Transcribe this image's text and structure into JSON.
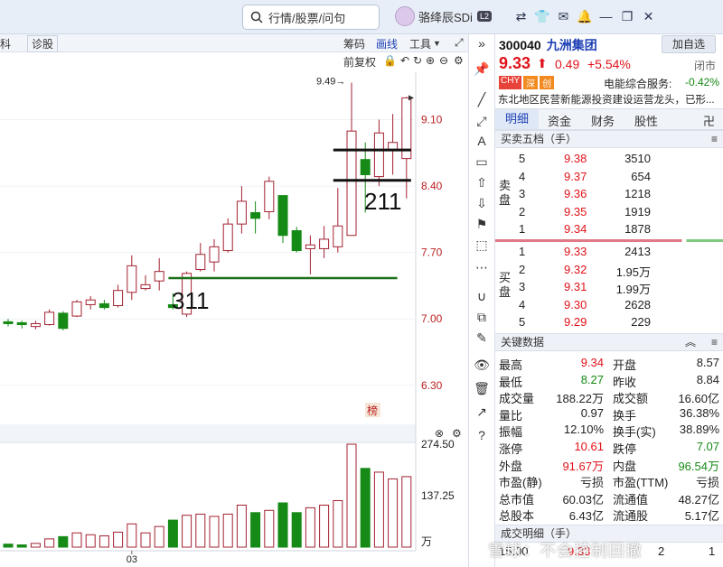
{
  "topbar": {
    "search_placeholder": "行情/股票/问句",
    "username": "骆绛辰SDi",
    "level": "L2"
  },
  "toolbar": {
    "left_partial": "科",
    "diag": "诊股",
    "chip": "筹码",
    "draw": "画线",
    "tools": "工具",
    "fuquan": "前复权"
  },
  "price_axis": [
    "9.10",
    "8.40",
    "7.70",
    "7.00",
    "6.30"
  ],
  "vol_axis": [
    "274.50",
    "137.25",
    "万"
  ],
  "date_label": "03",
  "annotations": {
    "high_label": "9.49",
    "a1": "311",
    "a2": "211",
    "bang": "榜"
  },
  "stock": {
    "code": "300040",
    "name": "九洲集团",
    "add": "加自选",
    "price": "9.33",
    "change": "0.49",
    "pct": "+5.54%",
    "status": "闭市",
    "tag1": "CHY",
    "tag2": "深",
    "tag3": "创",
    "sector": "电能综合服务:",
    "sector_pct": "-0.42%",
    "desc": "东北地区民营新能源投资建设运营龙头，已形..."
  },
  "tabs": [
    "明细",
    "资金",
    "财务",
    "股性"
  ],
  "orderbook": {
    "title": "买卖五档（手）",
    "sell_label": "卖盘",
    "buy_label": "买盘",
    "asks": [
      {
        "n": "5",
        "p": "9.38",
        "v": "3510"
      },
      {
        "n": "4",
        "p": "9.37",
        "v": "654"
      },
      {
        "n": "3",
        "p": "9.36",
        "v": "1218"
      },
      {
        "n": "2",
        "p": "9.35",
        "v": "1919"
      },
      {
        "n": "1",
        "p": "9.34",
        "v": "1878"
      }
    ],
    "bids": [
      {
        "n": "1",
        "p": "9.33",
        "v": "2413"
      },
      {
        "n": "2",
        "p": "9.32",
        "v": "1.95万"
      },
      {
        "n": "3",
        "p": "9.31",
        "v": "1.99万"
      },
      {
        "n": "4",
        "p": "9.30",
        "v": "2628"
      },
      {
        "n": "5",
        "p": "9.29",
        "v": "229"
      }
    ]
  },
  "key": {
    "title": "关键数据",
    "rows": [
      [
        "最高",
        "9.34",
        "开盘",
        "8.57"
      ],
      [
        "最低",
        "8.27",
        "昨收",
        "8.84"
      ],
      [
        "成交量",
        "188.22万",
        "成交额",
        "16.60亿"
      ],
      [
        "量比",
        "0.97",
        "换手",
        "36.38%"
      ],
      [
        "振幅",
        "12.10%",
        "换手(实)",
        "38.89%"
      ],
      [
        "涨停",
        "10.61",
        "跌停",
        "7.07"
      ],
      [
        "外盘",
        "91.67万",
        "内盘",
        "96.54万"
      ],
      [
        "市盈(静)",
        "亏损",
        "市盈(TTM)",
        "亏损"
      ],
      [
        "总市值",
        "60.03亿",
        "流通值",
        "48.27亿"
      ],
      [
        "总股本",
        "6.43亿",
        "流通股",
        "5.17亿"
      ]
    ]
  },
  "trades": {
    "title": "成交明细（手）",
    "row": {
      "t": "15:00",
      "p": "9.33",
      "v": "2",
      "n": "1"
    }
  },
  "watermark": "雪球：不会控制回撤",
  "colors": {
    "up": "#e0131a",
    "down": "#168a16",
    "accent": "#1d3fb5"
  },
  "chart_data": {
    "type": "candlestick",
    "candles": [
      {
        "o": 6.97,
        "c": 6.95,
        "h": 7.0,
        "l": 6.92
      },
      {
        "o": 6.96,
        "c": 6.94,
        "h": 6.98,
        "l": 6.9
      },
      {
        "o": 6.92,
        "c": 6.95,
        "h": 6.98,
        "l": 6.89
      },
      {
        "o": 6.94,
        "c": 7.07,
        "h": 7.1,
        "l": 6.93
      },
      {
        "o": 7.06,
        "c": 6.9,
        "h": 7.08,
        "l": 6.88
      },
      {
        "o": 7.03,
        "c": 7.18,
        "h": 7.2,
        "l": 7.02
      },
      {
        "o": 7.15,
        "c": 7.2,
        "h": 7.24,
        "l": 7.1
      },
      {
        "o": 7.16,
        "c": 7.12,
        "h": 7.2,
        "l": 7.1
      },
      {
        "o": 7.14,
        "c": 7.3,
        "h": 7.36,
        "l": 7.12
      },
      {
        "o": 7.28,
        "c": 7.56,
        "h": 7.67,
        "l": 7.2
      },
      {
        "o": 7.32,
        "c": 7.36,
        "h": 7.46,
        "l": 7.3
      },
      {
        "o": 7.4,
        "c": 7.5,
        "h": 7.64,
        "l": 7.3
      },
      {
        "o": 7.15,
        "c": 7.12,
        "h": 7.27,
        "l": 7.1
      },
      {
        "o": 7.05,
        "c": 7.48,
        "h": 7.5,
        "l": 7.02
      },
      {
        "o": 7.52,
        "c": 7.68,
        "h": 7.8,
        "l": 7.5
      },
      {
        "o": 7.6,
        "c": 7.76,
        "h": 7.84,
        "l": 7.5
      },
      {
        "o": 7.72,
        "c": 8.0,
        "h": 8.06,
        "l": 7.7
      },
      {
        "o": 8.0,
        "c": 8.24,
        "h": 8.4,
        "l": 7.9
      },
      {
        "o": 8.12,
        "c": 8.06,
        "h": 8.24,
        "l": 7.9
      },
      {
        "o": 8.13,
        "c": 8.45,
        "h": 8.5,
        "l": 8.05
      },
      {
        "o": 8.3,
        "c": 7.88,
        "h": 8.3,
        "l": 7.8
      },
      {
        "o": 7.93,
        "c": 7.72,
        "h": 7.97,
        "l": 7.7
      },
      {
        "o": 7.74,
        "c": 7.78,
        "h": 7.88,
        "l": 7.47
      },
      {
        "o": 7.74,
        "c": 7.84,
        "h": 7.98,
        "l": 7.64
      },
      {
        "o": 7.76,
        "c": 7.98,
        "h": 8.38,
        "l": 7.7
      },
      {
        "o": 7.88,
        "c": 8.98,
        "h": 9.49,
        "l": 7.88
      },
      {
        "o": 8.68,
        "c": 8.52,
        "h": 8.86,
        "l": 8.12
      },
      {
        "o": 8.5,
        "c": 8.96,
        "h": 9.1,
        "l": 8.4
      },
      {
        "o": 8.78,
        "c": 8.86,
        "h": 9.16,
        "l": 8.52
      },
      {
        "o": 8.69,
        "c": 9.33,
        "h": 9.34,
        "l": 8.27
      }
    ],
    "volumes": [
      {
        "v": 8,
        "u": 0
      },
      {
        "v": 6,
        "u": 0
      },
      {
        "v": 10,
        "u": 1
      },
      {
        "v": 22,
        "u": 1
      },
      {
        "v": 28,
        "u": 0
      },
      {
        "v": 38,
        "u": 1
      },
      {
        "v": 33,
        "u": 1
      },
      {
        "v": 30,
        "u": 1
      },
      {
        "v": 40,
        "u": 1
      },
      {
        "v": 62,
        "u": 1
      },
      {
        "v": 38,
        "u": 1
      },
      {
        "v": 55,
        "u": 1
      },
      {
        "v": 72,
        "u": 0
      },
      {
        "v": 85,
        "u": 1
      },
      {
        "v": 88,
        "u": 1
      },
      {
        "v": 82,
        "u": 1
      },
      {
        "v": 88,
        "u": 1
      },
      {
        "v": 112,
        "u": 1
      },
      {
        "v": 92,
        "u": 0
      },
      {
        "v": 98,
        "u": 1
      },
      {
        "v": 118,
        "u": 0
      },
      {
        "v": 92,
        "u": 0
      },
      {
        "v": 105,
        "u": 1
      },
      {
        "v": 112,
        "u": 1
      },
      {
        "v": 124,
        "u": 1
      },
      {
        "v": 274.5,
        "u": 1
      },
      {
        "v": 210,
        "u": 0
      },
      {
        "v": 200,
        "u": 1
      },
      {
        "v": 182,
        "u": 1
      },
      {
        "v": 188,
        "u": 1
      }
    ],
    "ylim": [
      6.0,
      9.6
    ],
    "vol_max": 274.5,
    "lines": [
      {
        "x0": 12,
        "x1": 28,
        "y": 7.43
      },
      {
        "x0": 24,
        "x1": 29,
        "y": 8.78
      },
      {
        "x0": 24,
        "x1": 29,
        "y": 8.46
      }
    ]
  }
}
